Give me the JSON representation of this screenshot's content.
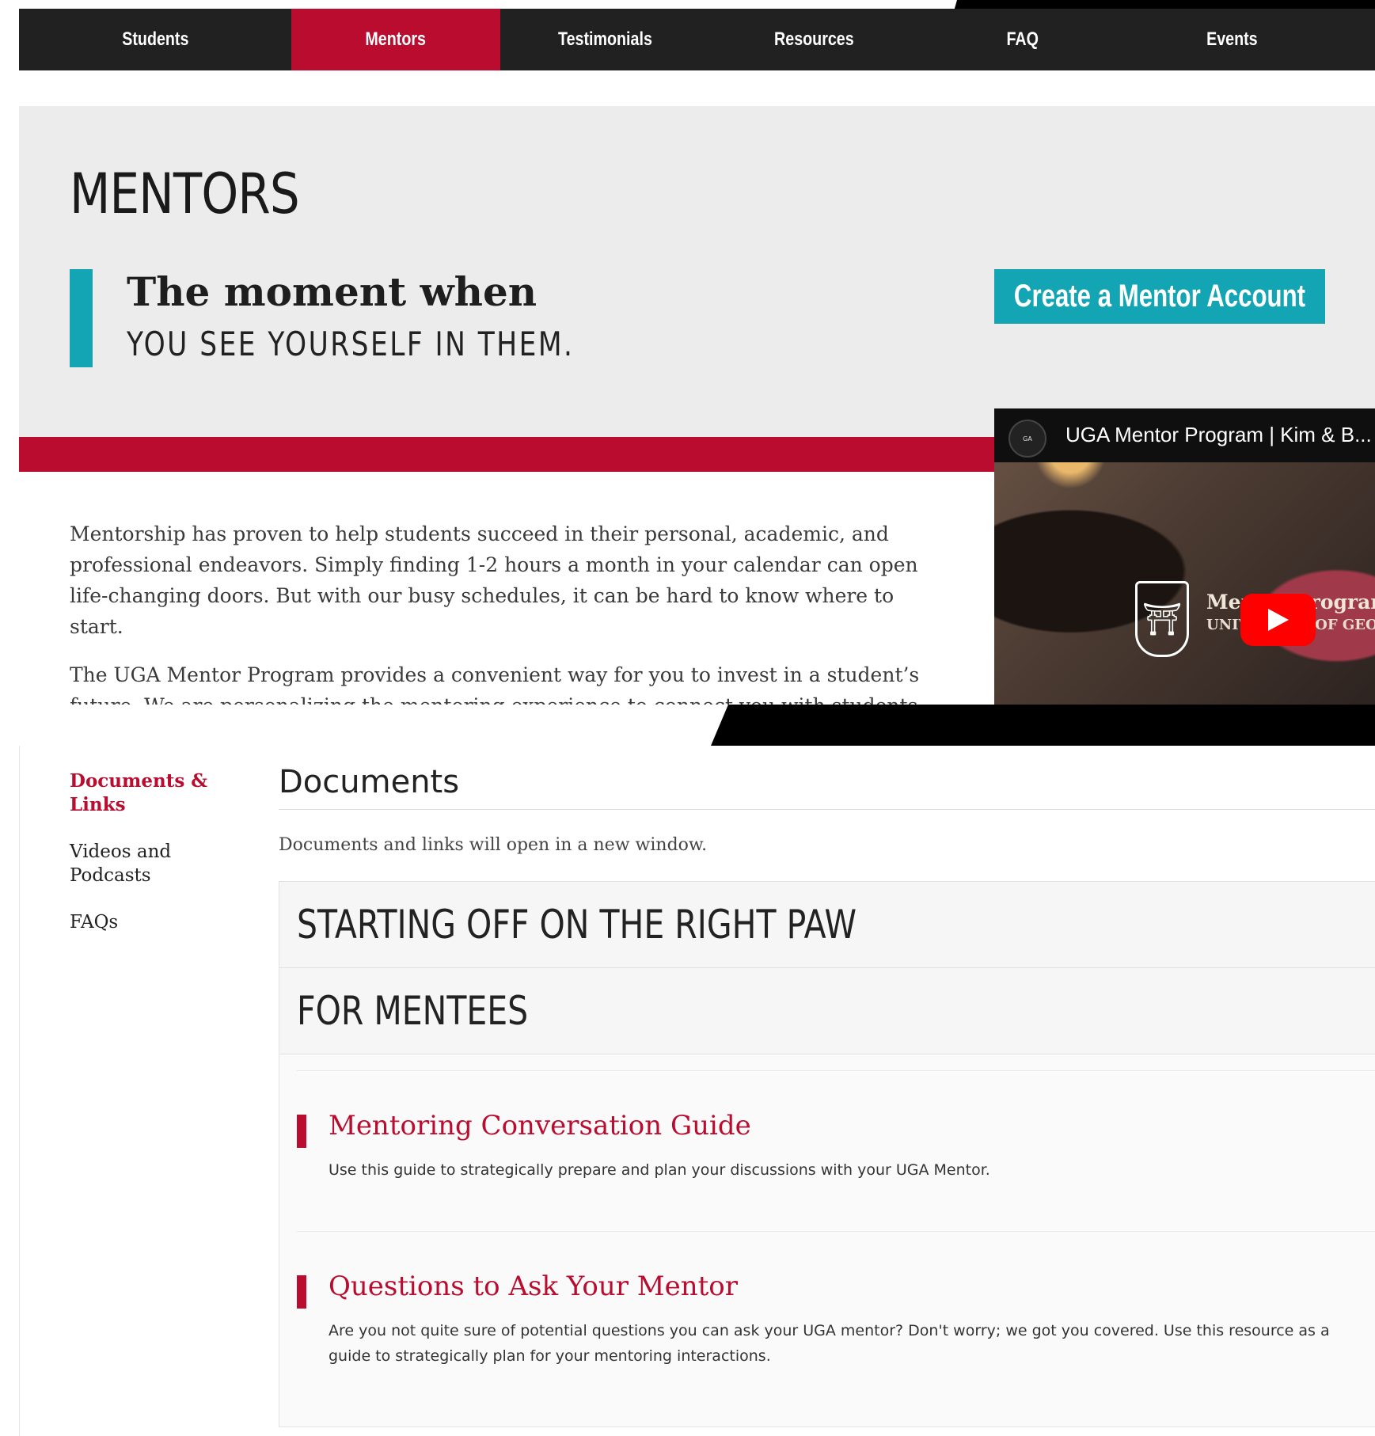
{
  "nav": {
    "items": [
      {
        "label": "Students"
      },
      {
        "label": "Mentors"
      },
      {
        "label": "Testimonials"
      },
      {
        "label": "Resources"
      },
      {
        "label": "FAQ"
      },
      {
        "label": "Events"
      }
    ],
    "active": "Mentors"
  },
  "hero": {
    "title": "MENTORS",
    "quote_line1": "The moment when",
    "quote_line2": "YOU SEE YOURSELF IN THEM.",
    "cta_label": "Create a Mentor Account"
  },
  "video": {
    "title": "UGA Mentor Program | Kim & B...",
    "channel_icon": "georgia-alumni-logo",
    "overlay_line1": "Mentor Program",
    "overlay_line2": "UNIVERSITY OF GEORGIA"
  },
  "intro": {
    "paragraph1": "Mentorship has proven to help students succeed in their personal, academic, and professional endeavors. Simply finding 1-2 hours a month in your calendar can open life-changing doors. But with our busy schedules, it can be hard to know where to start.",
    "paragraph2": "The UGA Mentor Program provides a convenient way for you to invest in a student’s future. We are personalizing the mentoring experience to connect you with students no"
  },
  "sidebar": {
    "items": [
      {
        "label": "Documents & Links"
      },
      {
        "label": "Videos and Podcasts"
      },
      {
        "label": "FAQs"
      }
    ]
  },
  "documents": {
    "title": "Documents",
    "note": "Documents and links will open in a new window.",
    "section1": "STARTING OFF ON THE RIGHT PAW",
    "section2": "FOR MENTEES",
    "resources": [
      {
        "title": "Mentoring Conversation Guide",
        "description": "Use this guide to strategically prepare and plan your discussions with your UGA Mentor."
      },
      {
        "title": "Questions to Ask Your Mentor",
        "description": "Are you not quite sure of potential questions you can ask your UGA mentor? Don't worry; we got you covered. Use this resource as a guide to strategically plan for your mentoring interactions."
      }
    ]
  },
  "colors": {
    "accent_red": "#ba0c2f",
    "accent_teal": "#14a5b4",
    "nav_bg": "#212121"
  }
}
